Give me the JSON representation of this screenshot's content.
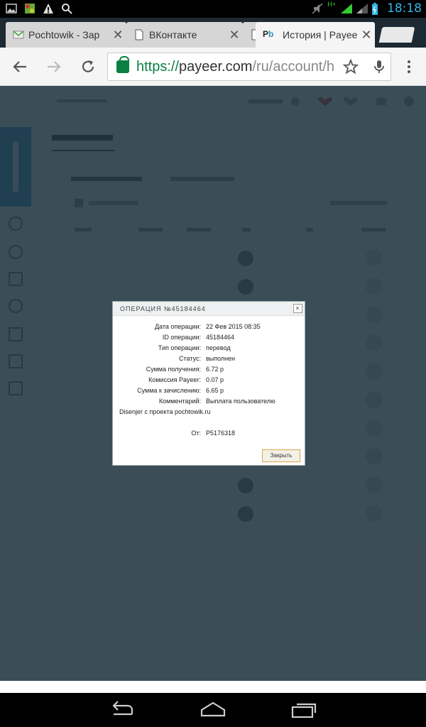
{
  "status_bar": {
    "time": "18:18",
    "network_label": "H+"
  },
  "tabs": [
    {
      "title": "Pochtowik - Зар",
      "favicon": "envelope-icon"
    },
    {
      "title": "ВКонтакте",
      "favicon": "page-icon"
    },
    {
      "title": "История | Payee",
      "favicon": "payeer-icon",
      "active": true
    }
  ],
  "toolbar": {
    "url_scheme": "https://",
    "url_host": "payeer.com",
    "url_path": "/ru/account/h"
  },
  "modal": {
    "title": "ОПЕРАЦИЯ №45184464",
    "close_symbol": "×",
    "fields": [
      {
        "label": "Дата операции:",
        "value": "22 Фев 2015 08:35"
      },
      {
        "label": "ID операции:",
        "value": "45184464"
      },
      {
        "label": "Тип операции:",
        "value": "перевод"
      },
      {
        "label": "Статус:",
        "value": "выполнен"
      },
      {
        "label": "Сумма получения:",
        "value": "6.72 р"
      },
      {
        "label": "Комиссия Payeer:",
        "value": "0.07 р"
      },
      {
        "label": "Сумма к зачислению:",
        "value": "6.65 р"
      },
      {
        "label": "Комментарий:",
        "value": "Выплата пользователю"
      }
    ],
    "comment_continuation": "Disenjer с проекта pochtowik.ru",
    "from_label": "От:",
    "from_value": "P5176318",
    "close_button": "Закрыть"
  },
  "colors": {
    "url_green": "#0b8043",
    "status_blue": "#33b5e5",
    "brand_blue": "#2d8fc5",
    "button_border": "#d8a64c"
  }
}
